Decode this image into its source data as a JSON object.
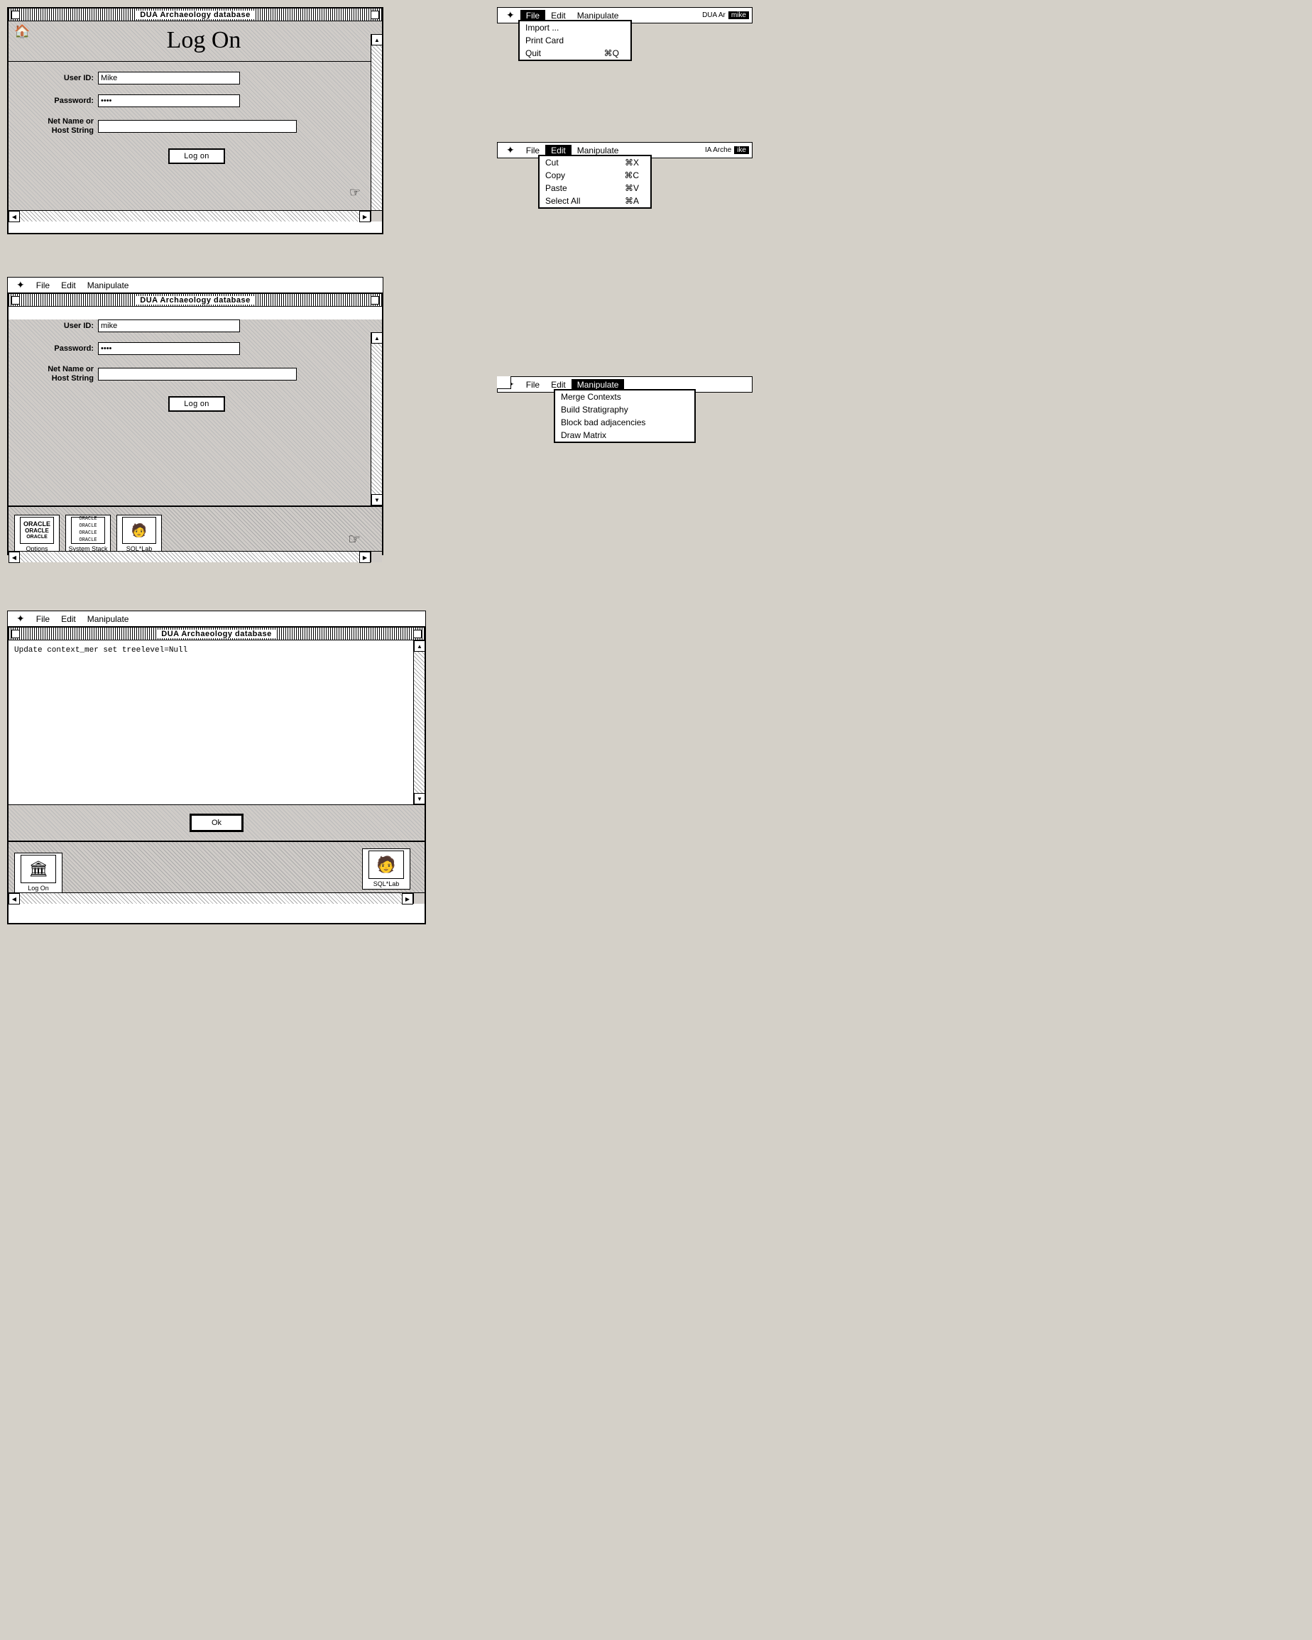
{
  "window1": {
    "title": "DUA Archaeology database",
    "heading": "Log On",
    "fields": {
      "userid_label": "User ID:",
      "userid_value": "Mike",
      "password_label": "Password:",
      "password_value": "••••",
      "netname_label_line1": "Net Name or",
      "netname_label_line2": "Host String",
      "netname_value": ""
    },
    "button_label": "Log on"
  },
  "menu1": {
    "apple": "✦",
    "file_label": "File",
    "edit_label": "Edit",
    "manipulate_label": "Manipulate",
    "active_menu": "File",
    "items": [
      "Import ...",
      "Print Card",
      "Quit"
    ],
    "shortcuts": [
      "",
      "",
      "⌘Q"
    ],
    "window_partial": "DUA Ar",
    "user_partial": "mike"
  },
  "menu2": {
    "apple": "✦",
    "file_label": "File",
    "edit_label": "Edit",
    "manipulate_label": "Manipulate",
    "active_menu": "Edit",
    "items": [
      "Cut",
      "Copy",
      "Paste",
      "Select All"
    ],
    "shortcuts": [
      "⌘X",
      "⌘C",
      "⌘V",
      "⌘A"
    ],
    "window_partial": "IA Arche",
    "user_partial": "ike"
  },
  "window2": {
    "title": "DUA Archaeology database",
    "menubar": {
      "apple": "✦",
      "file": "File",
      "edit": "Edit",
      "manipulate": "Manipulate"
    },
    "fields": {
      "userid_label": "User ID:",
      "userid_value": "mike",
      "password_label": "Password:",
      "password_value": "••••",
      "netname_label_line1": "Net Name or",
      "netname_label_line2": "Host String",
      "netname_value": ""
    },
    "button_label": "Log on",
    "toolbar": {
      "btn1_label": "Options",
      "btn2_label": "System Stack",
      "btn3_label": "SQL*Lab"
    }
  },
  "menu3": {
    "apple": "✦",
    "file_label": "File",
    "edit_label": "Edit",
    "manipulate_label": "Manipulate",
    "active_menu": "Manipulate",
    "items": [
      "Merge Contexts",
      "Build Stratigraphy",
      "Block bad adjacencies",
      "Draw Matrix"
    ]
  },
  "window3": {
    "title": "DUA Archaeology database",
    "menubar": {
      "apple": "✦",
      "file": "File",
      "edit": "Edit",
      "manipulate": "Manipulate"
    },
    "content": "Update context_mer set treelevel=Null",
    "button_label": "Ok",
    "toolbar": {
      "btn1_label": "Log On",
      "btn2_label": "SQL*Lab"
    }
  }
}
